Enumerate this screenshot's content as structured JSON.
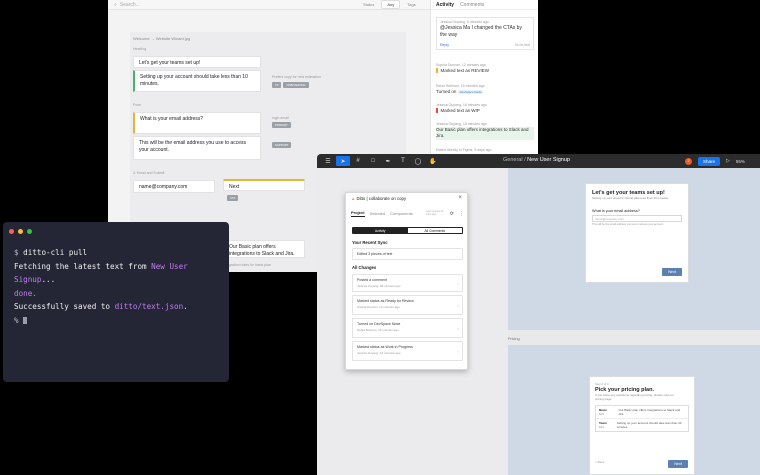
{
  "web": {
    "search_placeholder": "Search...",
    "filters": [
      "Status",
      "Any",
      "Tags"
    ],
    "breadcrumb": "Welcome → Website Wizard.jpg",
    "sections": {
      "heading": "Heading",
      "form": "Form",
      "section3": "3. Email and Submit"
    },
    "cards": {
      "teams_title": "Let's get your teams set up!",
      "setup_time": "Setting up your account should take less than 10 minutes.",
      "email_q": "What is your email address?",
      "email_desc": "This will be the email address you use to access your account.",
      "email_placeholder": "name@company.com",
      "next_btn": "Next",
      "basic_plan": "Our Basic plan offers integrations to Slack and Jira."
    },
    "meta": {
      "setup_note": "Prefers copy for new estimation",
      "setup_tags": [
        "V5",
        "ONBOARDING"
      ],
      "email_note": "login email",
      "email_tag": "PRIMARY",
      "desc_tag": "SUPPORT",
      "next_tag": "CTA",
      "basic_note": "Integration notes for basic plan"
    },
    "activity": {
      "tab_activity": "Activity",
      "tab_comments": "Comments",
      "resolve": "Resolve",
      "items": [
        {
          "meta": "Jessica Ouyang, 5 minutes ago",
          "text": "@Jessica Ma I changed the CTAs by the way",
          "reply": "Reply",
          "goto": "Go to text"
        },
        {
          "meta": "Sophia Duncan, 12 minutes ago",
          "text": "Marked text as REVIEW"
        },
        {
          "meta": "Rahul Bellman, 15 minutes ago",
          "text": "Turned on",
          "code": "DevSpace Node"
        },
        {
          "meta": "Jessica Ouyang, 16 minutes ago",
          "text": "Marked text as WIP"
        },
        {
          "meta": "Jessica Ouyang, 18 minutes ago",
          "text": "Our Basic plan offers integrations to Slack and Jira."
        },
        {
          "meta": "Edited directly in Figma, 5 days ago",
          "text": ""
        }
      ]
    }
  },
  "terminal": {
    "prompt": "$",
    "command": "ditto-cli pull",
    "fetch_prefix": "Fetching the latest text from ",
    "project_name": "New User Signup",
    "fetch_suffix": "...",
    "done": "done.",
    "saved_prefix": "Successfully saved to ",
    "saved_path": "ditto/text.json",
    "saved_suffix": ".",
    "prompt2": "%"
  },
  "figma": {
    "breadcrumb_team": "General",
    "breadcrumb_sep": "/",
    "file_name": "New User Signup",
    "share": "Share",
    "zoom": "55%",
    "avatar": "J",
    "frame2_label": "Pricing",
    "mock1": {
      "title": "Let's get your teams set up!",
      "sub": "Setting up your account should take less than 10 minutes.",
      "label": "What is your email address?",
      "placeholder": "name@company.com",
      "hint": "This will be the email address you use to access your account.",
      "btn": "Next"
    },
    "mock2": {
      "step": "Step 2 of 3",
      "title": "Pick your pricing plan.",
      "sub": "If you have any questions regarding pricing, please visit our pricing page.",
      "plans": [
        {
          "name": "Basic",
          "price": "$29",
          "desc": "Our Basic plan offers integrations to Slack and Jira."
        },
        {
          "name": "Team",
          "price": "$49",
          "desc": "Setting up your account should take less than 10 minutes."
        }
      ],
      "back": "< Back",
      "btn": "Next"
    }
  },
  "plugin": {
    "header": "Ditto | collaborate on copy",
    "tabs": [
      "Project",
      "Selected",
      "Components"
    ],
    "last_sync": "Last synced 12 mins ago",
    "toggle": [
      "Activity",
      "All Comments"
    ],
    "recent_sync_title": "Your Recent Sync",
    "recent_sync_text": "Edited 3 pieces of text",
    "all_changes_title": "All Changes",
    "changes": [
      {
        "text": "Posted a comment",
        "meta": "Jessica Ouyang, 28 minutes ago"
      },
      {
        "text": "Marked status as  Ready for Review",
        "meta": "Sophia Duncan, 12 minutes ago"
      },
      {
        "text": "Turned on  DevSpace Node",
        "meta": "Rahul Bellman, 15 minutes ago"
      },
      {
        "text": "Marked status as  Work in Progress",
        "meta": "Jessica Ouyang, 16 minutes ago"
      }
    ]
  },
  "colors": {
    "terminal_bg": "#242635",
    "purple_highlight": "#c07cf2",
    "figma_toolbar": "#2c2c2c",
    "share_blue": "#1a73e8",
    "button_blue": "#5d80b2"
  }
}
